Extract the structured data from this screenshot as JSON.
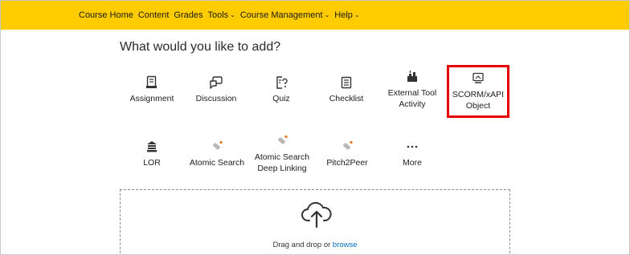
{
  "nav": {
    "items": [
      {
        "label": "Course Home",
        "dropdown": false
      },
      {
        "label": "Content",
        "dropdown": false
      },
      {
        "label": "Grades",
        "dropdown": false
      },
      {
        "label": "Tools",
        "dropdown": true
      },
      {
        "label": "Course Management",
        "dropdown": true
      },
      {
        "label": "Help",
        "dropdown": true
      }
    ],
    "background": "#ffcc00"
  },
  "heading": "What would you like to add?",
  "tiles": {
    "assignment": {
      "line1": "Assignment",
      "line2": "",
      "icon": "assignment-icon"
    },
    "discussion": {
      "line1": "Discussion",
      "line2": "",
      "icon": "discussion-icon"
    },
    "quiz": {
      "line1": "Quiz",
      "line2": "",
      "icon": "quiz-icon"
    },
    "checklist": {
      "line1": "Checklist",
      "line2": "",
      "icon": "checklist-icon"
    },
    "external_tool": {
      "line1": "External Tool",
      "line2": "Activity",
      "icon": "external-tool-icon"
    },
    "scorm": {
      "line1": "SCORM/xAPI",
      "line2": "Object",
      "icon": "scorm-icon"
    },
    "lor": {
      "line1": "LOR",
      "line2": "",
      "icon": "lor-icon"
    },
    "atomic_search": {
      "line1": "Atomic Search",
      "line2": "",
      "icon": "plugin-icon"
    },
    "atomic_deep": {
      "line1": "Atomic Search",
      "line2": "Deep Linking",
      "icon": "plugin-icon"
    },
    "pitch2peer": {
      "line1": "Pitch2Peer",
      "line2": "",
      "icon": "plugin-icon"
    },
    "more": {
      "line1": "More",
      "line2": "",
      "icon": "more-dots-icon"
    }
  },
  "highlight_color": "#e60000",
  "dropzone": {
    "text": "Drag and drop or",
    "link": "browse",
    "icon": "cloud-upload-icon"
  }
}
